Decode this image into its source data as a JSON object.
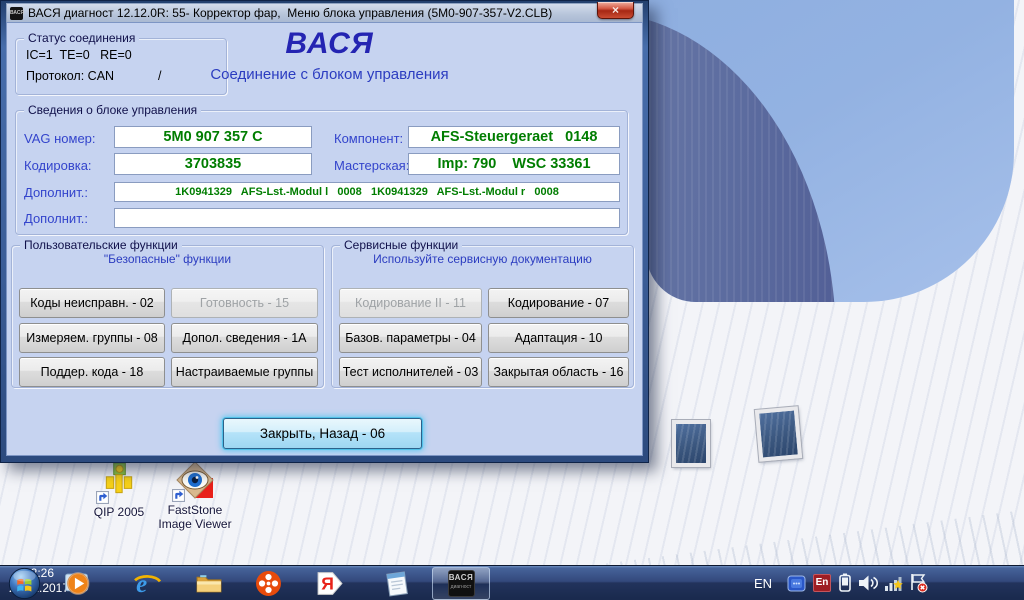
{
  "window": {
    "title": "ВАСЯ диагност 12.12.0R: 55- Корректор фар,  Меню блока управления (5M0-907-357-V2.CLB)",
    "icon_text": "ВАСЯ",
    "close_glyph": "×",
    "brand": "ВАСЯ",
    "brand_subtitle": "Соединение с блоком управления"
  },
  "status_group": {
    "title": "Статус соединения",
    "counters": "IC=1  TE=0   RE=0",
    "protocol": "Протокол: CAN",
    "spinner": "/"
  },
  "info_group": {
    "title": "Сведения о блоке управления",
    "fields": [
      {
        "label": "VAG номер:",
        "value": "5M0 907 357 C"
      },
      {
        "label": "Компонент:",
        "value": "AFS-Steuergeraet   0148"
      },
      {
        "label": "Кодировка:",
        "value": "3703835"
      },
      {
        "label": "Мастерская:",
        "value": "Imp: 790    WSC 33361"
      },
      {
        "label": "Дополнит.:",
        "value": "1K0941329   AFS-Lst.-Modul l   0008   1K0941329   AFS-Lst.-Modul r   0008"
      },
      {
        "label": "Дополнит.:",
        "value": ""
      }
    ]
  },
  "user_functions": {
    "title": "Пользовательские функции",
    "subtitle": "\"Безопасные\" функции",
    "buttons": [
      {
        "label": "Коды неисправн. - 02",
        "enabled": true
      },
      {
        "label": "Готовность - 15",
        "enabled": false
      },
      {
        "label": "Измеряем. группы - 08",
        "enabled": true
      },
      {
        "label": "Допол. сведения - 1A",
        "enabled": true
      },
      {
        "label": "Поддер. кода - 18",
        "enabled": true
      },
      {
        "label": "Настраиваемые группы",
        "enabled": true
      }
    ]
  },
  "service_functions": {
    "title": "Сервисные функции",
    "subtitle": "Используйте сервисную документацию",
    "buttons": [
      {
        "label": "Кодирование II - 11",
        "enabled": false
      },
      {
        "label": "Кодирование - 07",
        "enabled": true
      },
      {
        "label": "Базов. параметры - 04",
        "enabled": true
      },
      {
        "label": "Адаптация - 10",
        "enabled": true
      },
      {
        "label": "Тест исполнителей - 03",
        "enabled": true
      },
      {
        "label": "Закрытая область - 16",
        "enabled": true
      }
    ]
  },
  "footer": {
    "close_back": "Закрыть, Назад - 06"
  },
  "desktop_icons": [
    {
      "label": "QIP 2005"
    },
    {
      "label": "FastStone Image Viewer"
    }
  ],
  "taskbar": {
    "app_button": {
      "line1": "ВАСЯ",
      "line2": "диагност"
    },
    "tray": {
      "lang_indicator": "EN",
      "punto_lang": "En",
      "time": "22:26",
      "date": "21.12.2017"
    }
  },
  "colors": {
    "accent_green": "#007d00",
    "label_blue": "#3344cc",
    "dialog_bg": "#c6d3f0"
  }
}
